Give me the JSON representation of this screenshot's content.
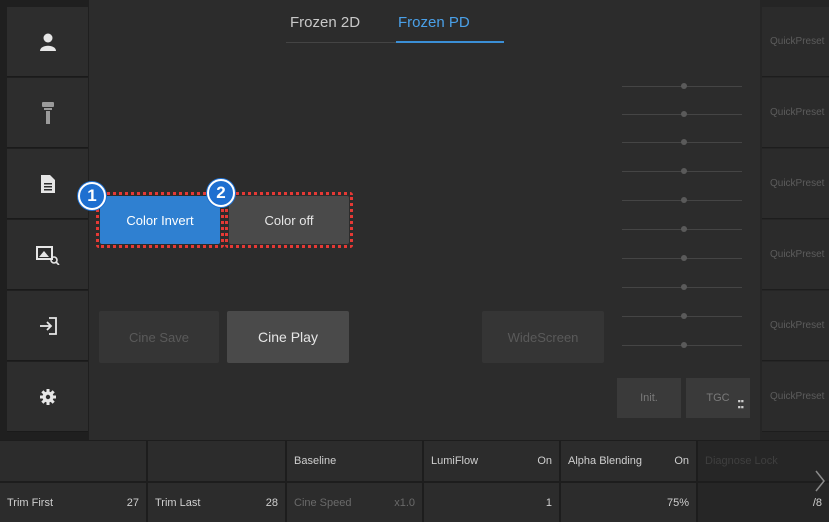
{
  "tabs": [
    {
      "label": "Frozen 2D",
      "active": false
    },
    {
      "label": "Frozen PD",
      "active": true
    }
  ],
  "sidebar": {
    "items": [
      {
        "icon": "user-icon"
      },
      {
        "icon": "probe-icon"
      },
      {
        "icon": "document-icon"
      },
      {
        "icon": "image-search-icon"
      },
      {
        "icon": "exit-icon"
      },
      {
        "icon": "gear-icon"
      }
    ]
  },
  "main": {
    "color_invert": "Color Invert",
    "color_off": "Color off",
    "cine_save": "Cine Save",
    "cine_play": "Cine Play",
    "widescreen": "WideScreen",
    "init": "Init.",
    "tgc": "TGC",
    "badge1": "1",
    "badge2": "2"
  },
  "quick_presets": [
    "QuickPreset",
    "QuickPreset",
    "QuickPreset",
    "QuickPreset",
    "QuickPreset",
    "QuickPreset"
  ],
  "bottom": {
    "row1": {
      "baseline": "Baseline",
      "lumiflow": {
        "label": "LumiFlow",
        "value": "On"
      },
      "alpha_blending": {
        "label": "Alpha Blending",
        "value": "On"
      },
      "faint": "Diagnose Lock"
    },
    "row2": {
      "trim_first": {
        "label": "Trim First",
        "value": "27"
      },
      "trim_last": {
        "label": "Trim Last",
        "value": "28"
      },
      "cine_speed": {
        "label": "Cine Speed",
        "value": "x1.0"
      },
      "lumiflow_value": "1",
      "alpha_value": "75%",
      "page": "/8"
    }
  },
  "colors": {
    "accent": "#2f80d1",
    "highlight": "#e53935"
  }
}
